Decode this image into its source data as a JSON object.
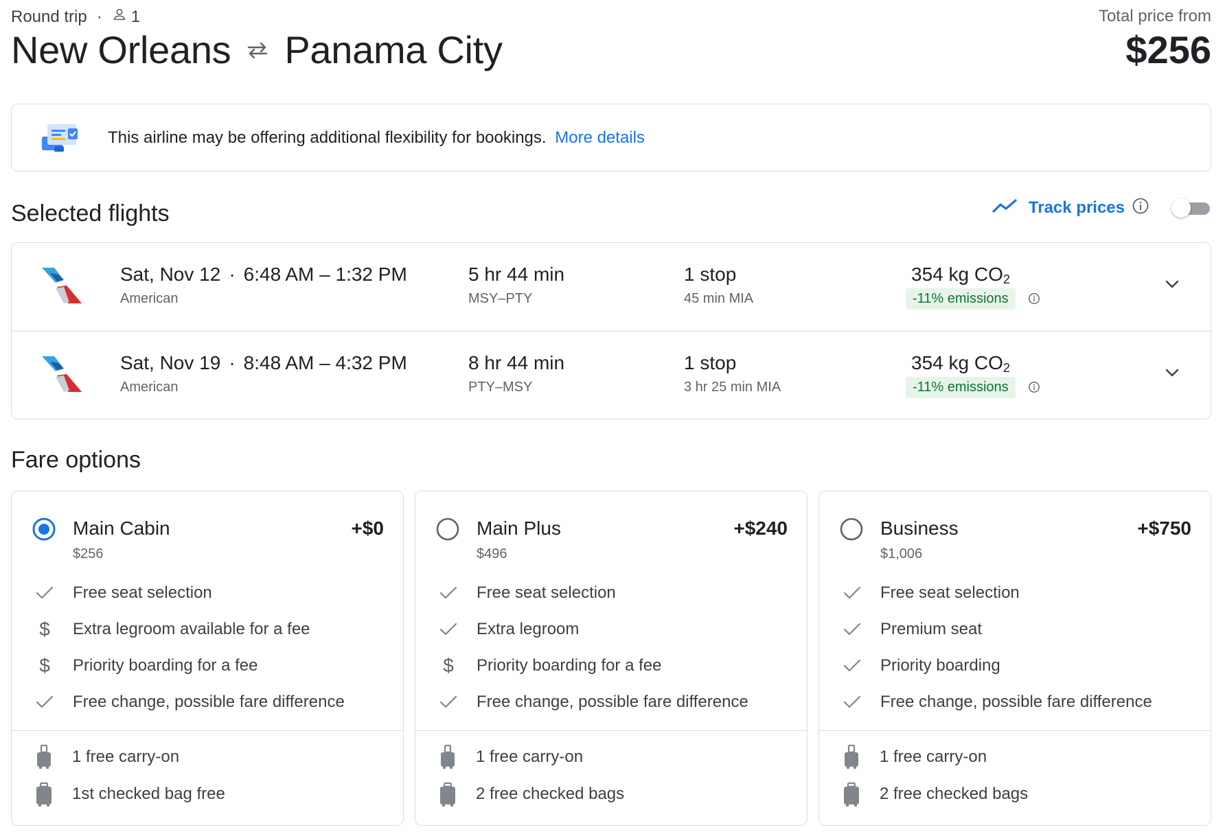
{
  "header": {
    "trip_type": "Round trip",
    "dot": "·",
    "passengers": "1",
    "origin": "New Orleans",
    "destination": "Panama City",
    "price_label": "Total price from",
    "price": "$256"
  },
  "banner": {
    "text": "This airline may be offering additional flexibility for bookings.",
    "link": "More details"
  },
  "selected_flights": {
    "title": "Selected flights",
    "track_label": "Track prices",
    "flights": [
      {
        "date": "Sat, Nov 12",
        "times": "6:48 AM – 1:32 PM",
        "airline": "American",
        "duration": "5 hr 44 min",
        "route": "MSY–PTY",
        "stops": "1 stop",
        "layover": "45 min MIA",
        "co2_value": "354 kg CO",
        "co2_sub": "2",
        "emissions": "-11% emissions"
      },
      {
        "date": "Sat, Nov 19",
        "times": "8:48 AM – 4:32 PM",
        "airline": "American",
        "duration": "8 hr 44 min",
        "route": "PTY–MSY",
        "stops": "1 stop",
        "layover": "3 hr 25 min MIA",
        "co2_value": "354 kg CO",
        "co2_sub": "2",
        "emissions": "-11% emissions"
      }
    ]
  },
  "fare_options": {
    "title": "Fare options",
    "fares": [
      {
        "name": "Main Cabin",
        "total": "$256",
        "delta": "+$0",
        "selected": true,
        "features": [
          {
            "icon": "check-icon",
            "text": "Free seat selection"
          },
          {
            "icon": "dollar-icon",
            "text": "Extra legroom available for a fee"
          },
          {
            "icon": "dollar-icon",
            "text": "Priority boarding for a fee"
          },
          {
            "icon": "check-icon",
            "text": "Free change, possible fare difference"
          }
        ],
        "bags": [
          "1 free carry-on",
          "1st checked bag free"
        ]
      },
      {
        "name": "Main Plus",
        "total": "$496",
        "delta": "+$240",
        "selected": false,
        "features": [
          {
            "icon": "check-icon",
            "text": "Free seat selection"
          },
          {
            "icon": "check-icon",
            "text": "Extra legroom"
          },
          {
            "icon": "dollar-icon",
            "text": "Priority boarding for a fee"
          },
          {
            "icon": "check-icon",
            "text": "Free change, possible fare difference"
          }
        ],
        "bags": [
          "1 free carry-on",
          "2 free checked bags"
        ]
      },
      {
        "name": "Business",
        "total": "$1,006",
        "delta": "+$750",
        "selected": false,
        "features": [
          {
            "icon": "check-icon",
            "text": "Free seat selection"
          },
          {
            "icon": "check-icon",
            "text": "Premium seat"
          },
          {
            "icon": "check-icon",
            "text": "Priority boarding"
          },
          {
            "icon": "check-icon",
            "text": "Free change, possible fare difference"
          }
        ],
        "bags": [
          "1 free carry-on",
          "2 free checked bags"
        ]
      }
    ]
  },
  "colors": {
    "accent": "#1a73e8",
    "emissions_bg": "#e6f4ea",
    "emissions_text": "#137333",
    "border": "#dadce0"
  }
}
